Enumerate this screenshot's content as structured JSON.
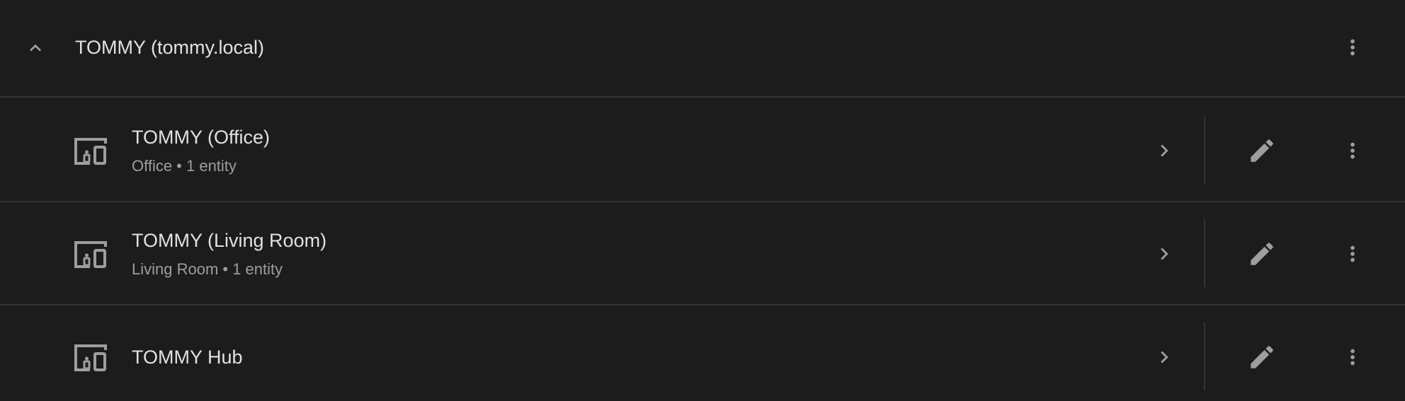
{
  "group": {
    "title": "TOMMY (tommy.local)",
    "collapse_icon": "chevron-up-icon",
    "menu_icon": "dots-vertical-icon"
  },
  "devices": [
    {
      "name": "TOMMY (Office)",
      "subtitle": "Office • 1 entity"
    },
    {
      "name": "TOMMY (Living Room)",
      "subtitle": "Living Room • 1 entity"
    },
    {
      "name": "TOMMY Hub",
      "subtitle": ""
    }
  ],
  "icons": {
    "device": "devices-icon",
    "navigate": "chevron-right-icon",
    "edit": "pencil-icon",
    "menu": "dots-vertical-icon"
  },
  "colors": {
    "background": "#1c1c1c",
    "divider": "#333333",
    "primary_text": "#e1e1e1",
    "secondary_text": "#9e9e9e",
    "icon": "#9e9e9e"
  }
}
